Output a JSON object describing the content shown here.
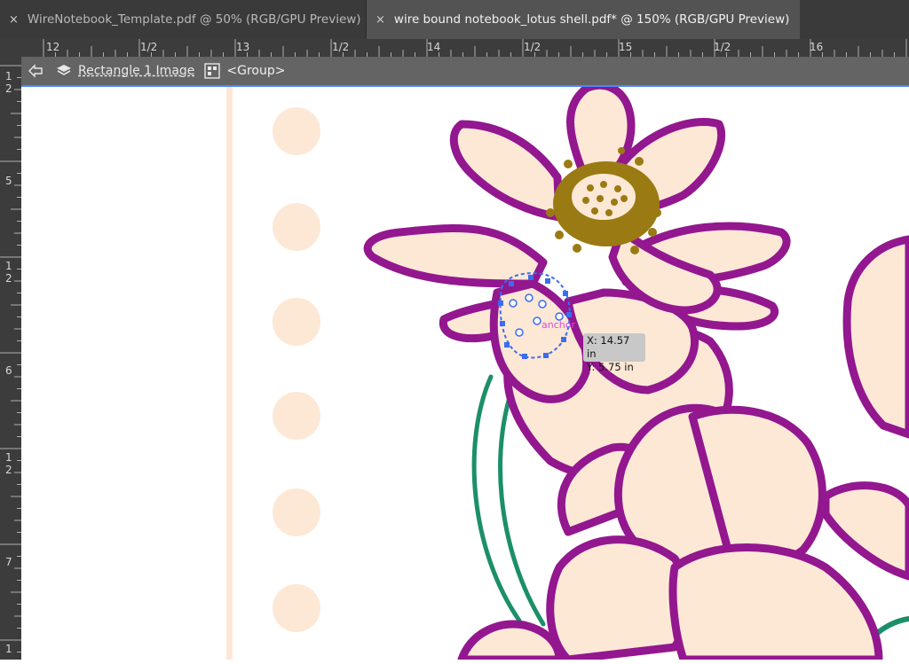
{
  "tabs": [
    {
      "close": "×",
      "label": "WireNotebook_Template.pdf @ 50% (RGB/GPU Preview)"
    },
    {
      "close": "×",
      "label": "wire bound notebook_lotus shell.pdf* @ 150% (RGB/GPU Preview)"
    }
  ],
  "ruler_top": {
    "labels": [
      "12",
      "1/2",
      "13",
      "1/2",
      "14",
      "1/2",
      "15",
      "1/2",
      "16"
    ]
  },
  "ruler_left": {
    "labels": [
      "1",
      "2",
      "5",
      "1",
      "2",
      "6",
      "1",
      "2",
      "7",
      "1"
    ]
  },
  "breadcrumb": {
    "item1": "Rectangle 1 Image",
    "item2": "<Group>"
  },
  "canvas": {
    "anchor_label": "anchor",
    "tooltip_x": "X: 14.57 in",
    "tooltip_y": "Y: 5.75 in"
  },
  "colors": {
    "purple": "#93178f",
    "cream": "#fde8d6",
    "olive": "#9a7a12",
    "green": "#1b8f6a",
    "selection": "#3c6cf0"
  }
}
